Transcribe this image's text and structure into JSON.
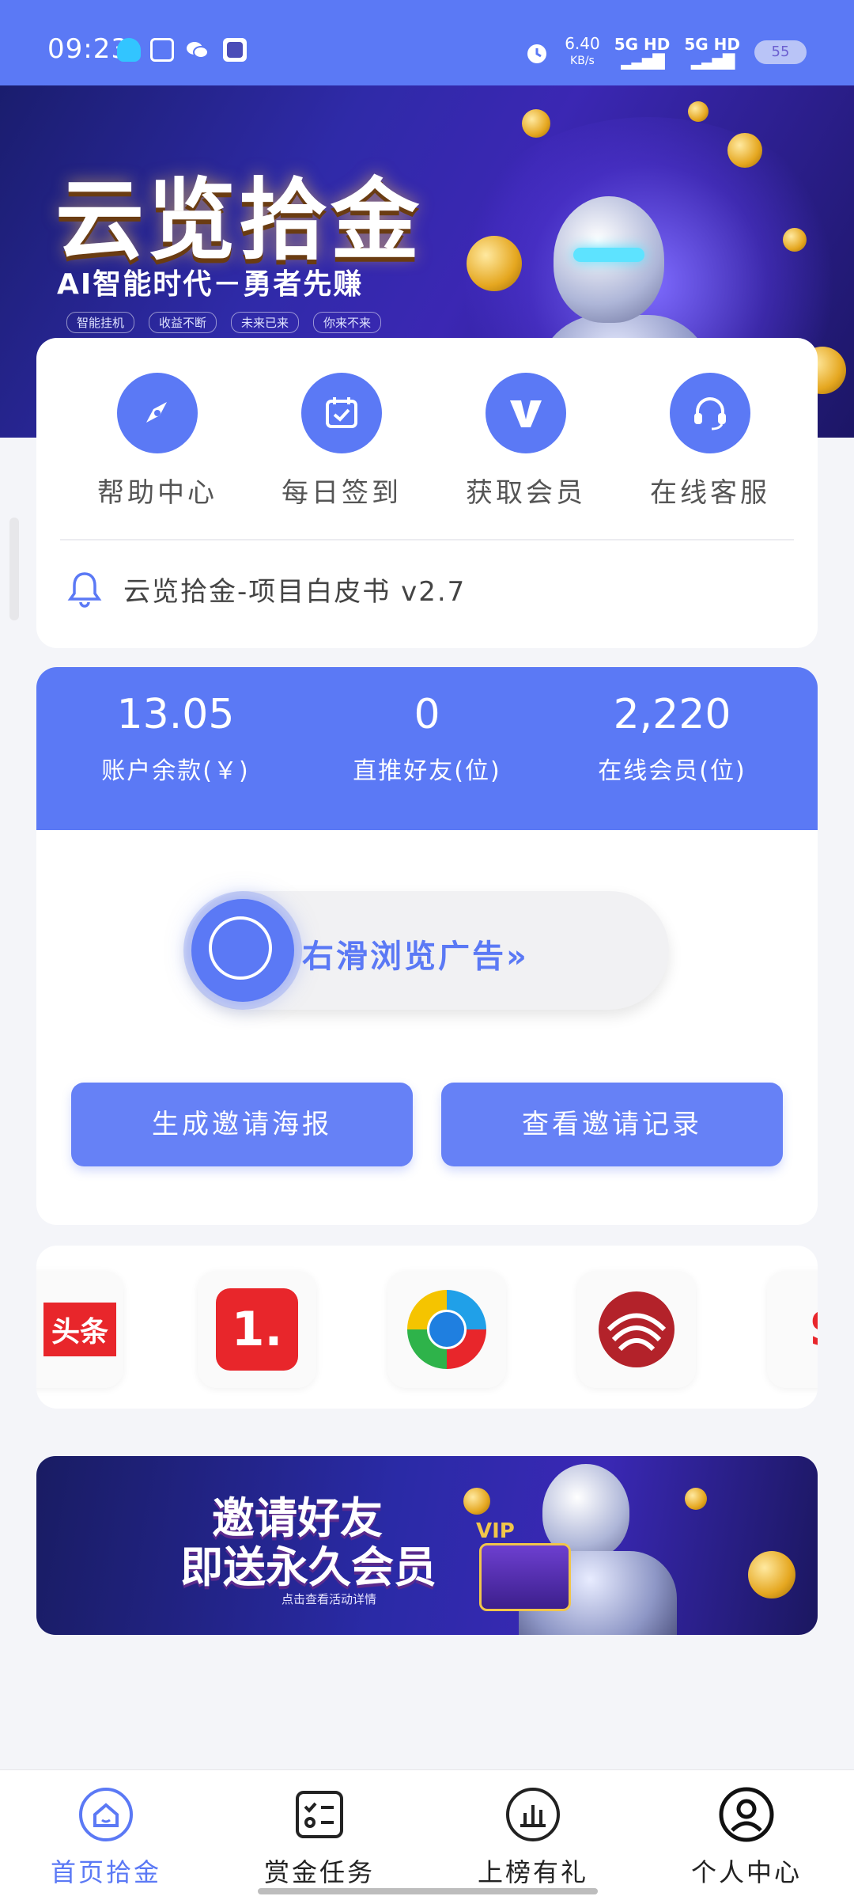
{
  "status_bar": {
    "time": "09:23",
    "net_speed": "6.40",
    "net_unit": "KB/s",
    "signal1": "5G HD",
    "signal2": "5G HD",
    "battery": "55"
  },
  "banner": {
    "title": "云览拾金",
    "subtitle": "AI智能时代－勇者先赚",
    "tags": [
      "智能挂机",
      "收益不断",
      "未来已来",
      "你来不来"
    ]
  },
  "quick_menu": [
    {
      "label": "帮助中心",
      "icon": "compass-icon"
    },
    {
      "label": "每日签到",
      "icon": "calendar-check-icon"
    },
    {
      "label": "获取会员",
      "icon": "vip-v-icon"
    },
    {
      "label": "在线客服",
      "icon": "headset-icon"
    }
  ],
  "notice": {
    "text": "云览拾金-项目白皮书 v2.7",
    "icon": "bell-icon"
  },
  "stats": [
    {
      "value": "13.05",
      "label": "账户余款(￥)"
    },
    {
      "value": "0",
      "label": "直推好友(位)"
    },
    {
      "value": "2,220",
      "label": "在线会员(位)"
    }
  ],
  "slider": {
    "text": "右滑浏览广告"
  },
  "buttons": {
    "poster": "生成邀请海报",
    "records": "查看邀请记录"
  },
  "apps": [
    {
      "name": "toutiao-logo",
      "text": "头条"
    },
    {
      "name": "yidian-logo",
      "text": "1."
    },
    {
      "name": "tencent-news-logo",
      "text": ""
    },
    {
      "name": "ifeng-logo",
      "text": ""
    },
    {
      "name": "sina-logo",
      "text": "S"
    }
  ],
  "invite_banner": {
    "line1": "邀请好友",
    "line2": "即送永久会员",
    "sub": "点击查看活动详情",
    "badge": "VIP"
  },
  "bottom_nav": [
    {
      "label": "首页拾金",
      "icon": "home-icon",
      "active": true
    },
    {
      "label": "赏金任务",
      "icon": "task-list-icon",
      "active": false
    },
    {
      "label": "上榜有礼",
      "icon": "bar-chart-icon",
      "active": false
    },
    {
      "label": "个人中心",
      "icon": "user-icon",
      "active": false
    }
  ],
  "colors": {
    "primary": "#5b79f5",
    "button": "#6681f6",
    "background": "#f4f5f9"
  }
}
